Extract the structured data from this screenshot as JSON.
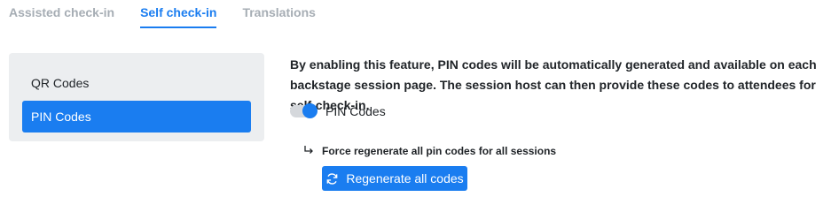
{
  "tabs": [
    {
      "label": "Assisted check-in",
      "active": false
    },
    {
      "label": "Self check-in",
      "active": true
    },
    {
      "label": "Translations",
      "active": false
    }
  ],
  "sidebar": {
    "items": [
      {
        "label": "QR Codes",
        "active": false
      },
      {
        "label": "PIN Codes",
        "active": true
      }
    ]
  },
  "main": {
    "description": "By enabling this feature, PIN codes will be automatically generated and available on each backstage session page. The session host can then provide these codes to attendees for self-check-in.",
    "toggle": {
      "label": "PIN Codes",
      "enabled": true
    },
    "regenerate": {
      "note": "Force regenerate all pin codes for all sessions",
      "button_label": "Regenerate all codes"
    }
  },
  "colors": {
    "accent": "#1a7df0",
    "panel_bg": "#eceef0",
    "inactive_tab": "#a6adb4"
  },
  "icons": {
    "sub_arrow": "arrow-return-right-icon",
    "refresh": "refresh-icon"
  }
}
